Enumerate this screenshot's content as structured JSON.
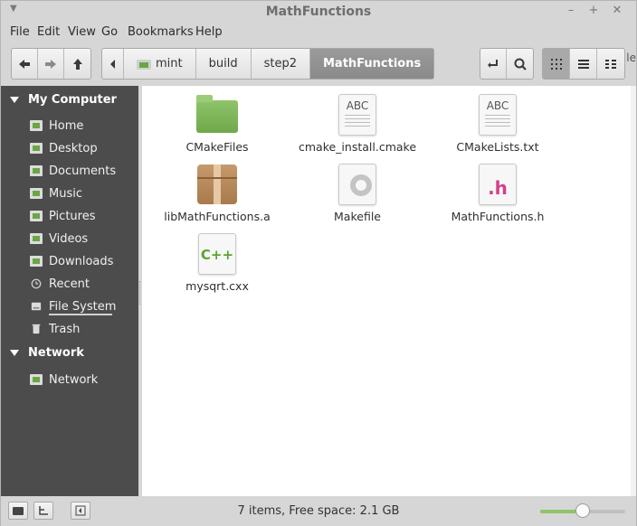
{
  "window": {
    "title": "MathFunctions"
  },
  "menubar": {
    "items": [
      "File",
      "Edit",
      "View",
      "Go",
      "Bookmarks",
      "Help"
    ]
  },
  "toolbar": {
    "breadcrumbs": [
      "mint",
      "build",
      "step2",
      "MathFunctions"
    ],
    "right_edge_text": "le"
  },
  "sidebar": {
    "sections": [
      {
        "heading": "My Computer",
        "items": [
          "Home",
          "Desktop",
          "Documents",
          "Music",
          "Pictures",
          "Videos",
          "Downloads",
          "Recent",
          "File System",
          "Trash"
        ]
      },
      {
        "heading": "Network",
        "items": [
          "Network"
        ]
      }
    ]
  },
  "files": [
    {
      "name": "CMakeFiles",
      "icon": "folder-icon"
    },
    {
      "name": "cmake_install.cmake",
      "icon": "text-file-icon",
      "badge": "ABC"
    },
    {
      "name": "CMakeLists.txt",
      "icon": "text-file-icon",
      "badge": "ABC"
    },
    {
      "name": "libMathFunctions.a",
      "icon": "archive-icon"
    },
    {
      "name": "Makefile",
      "icon": "makefile-gear-icon"
    },
    {
      "name": "MathFunctions.h",
      "icon": "header-file-icon",
      "badge": ".h"
    },
    {
      "name": "mysqrt.cxx",
      "icon": "cpp-file-icon",
      "badge": "C++"
    }
  ],
  "status": {
    "text": "7 items, Free space: 2.1 GB",
    "zoom_fraction": 0.5
  },
  "colors": {
    "sidebar_bg": "#4c4c4c",
    "folder_green": "#7ab356",
    "active_crumb": "#8f8f8f"
  }
}
